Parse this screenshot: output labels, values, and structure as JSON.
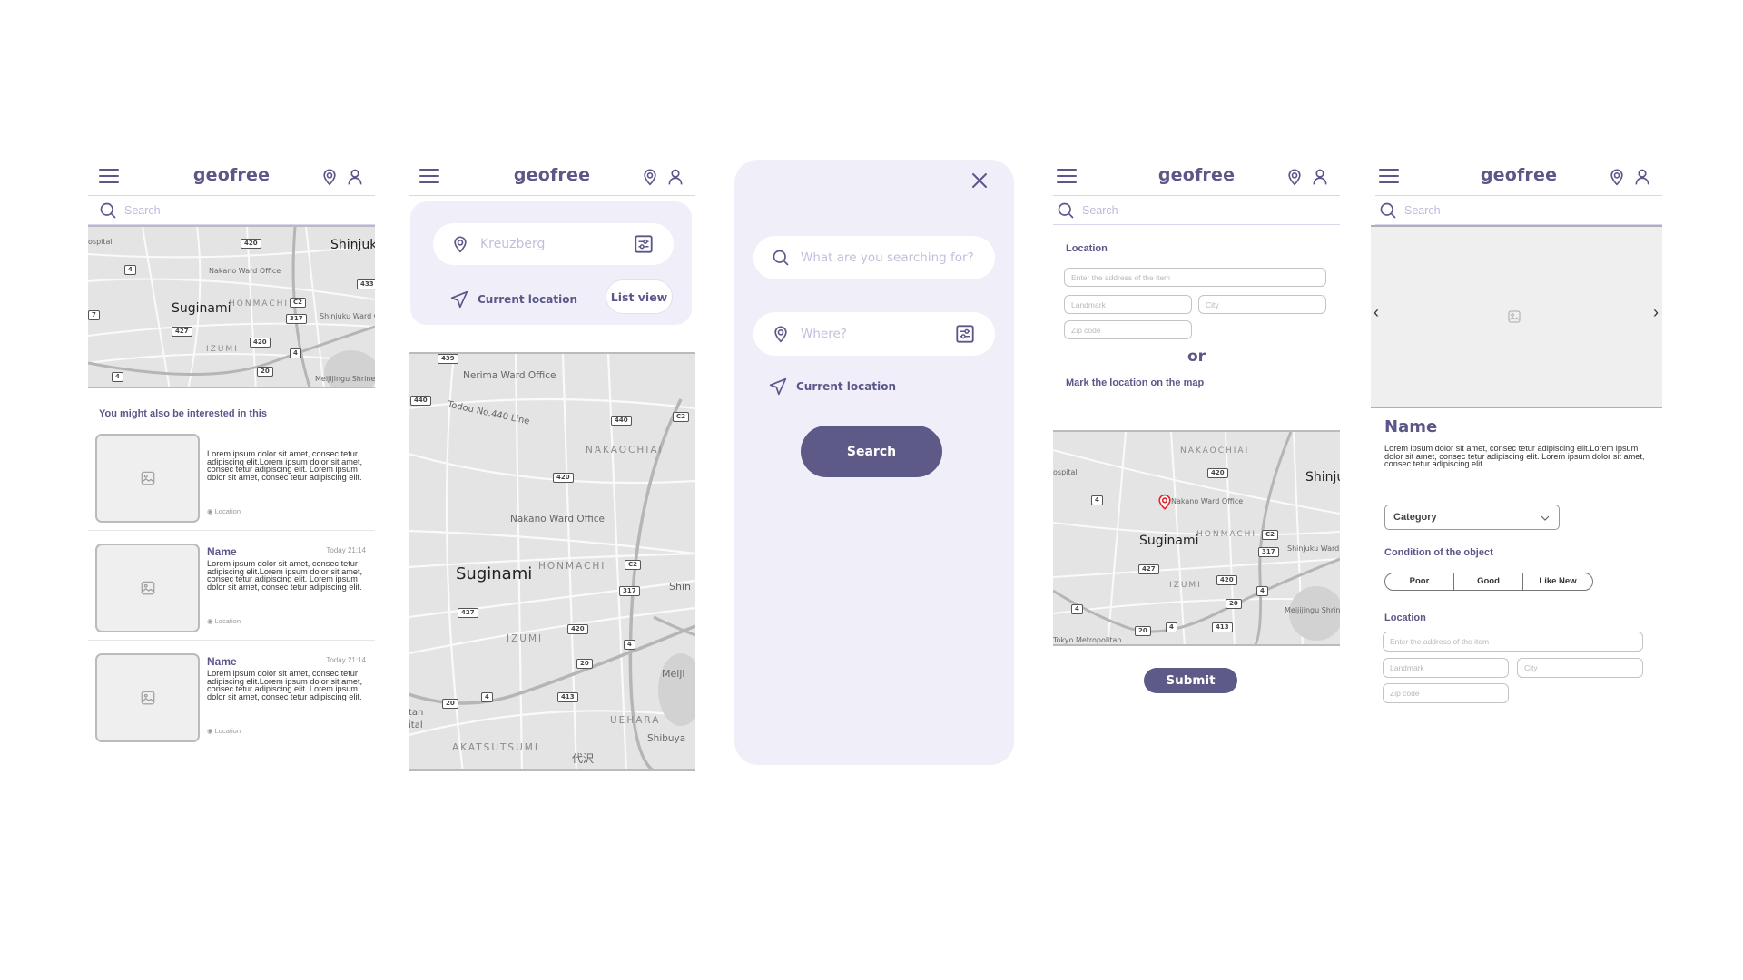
{
  "app": {
    "brand": "geofree",
    "search_placeholder": "Search"
  },
  "colors": {
    "accent": "#5b5789",
    "panel_bg": "#f0eff9",
    "map_pin": "#e0262c"
  },
  "icons": {
    "menu": "hamburger-icon",
    "location": "map-pin-icon",
    "profile": "user-icon",
    "search": "search-icon",
    "filter": "filter-sliders-icon",
    "navigate": "navigation-arrow-icon",
    "close": "close-icon",
    "image": "image-placeholder-icon",
    "prev": "chevron-left-icon",
    "next": "chevron-right-icon",
    "dropdown": "chevron-down-icon"
  },
  "map": {
    "labels": {
      "suginami": "Suginami",
      "shinjuku": "Shinjuk",
      "shinjuku_short": "Shinju",
      "shinjuku_large": "Shin",
      "nakano_office": "Nakano Ward Office",
      "nerima_office": "Nerima Ward Office",
      "shinjuku_office": "Shinjuku Ward O",
      "honmachi": "HONMACHI",
      "izumi": "IZUMI",
      "nakaochiai": "NAKAOCHIAI",
      "uehara": "UEHARA",
      "akatsutsumi": "AKATSUTSUMI",
      "meijijingu": "Meijijingu Shrine",
      "meijijingu_short": "Meiji",
      "shibuya": "Shibuya",
      "hospital": "ospital",
      "todou_line": "Todou No.440 Line",
      "daizawa": "代沢",
      "tokyo_metropolitan": "Tokyo Metropolitan",
      "tan": "tan",
      "ital": "ital"
    },
    "routes": [
      "420",
      "4",
      "433",
      "C2",
      "317",
      "427",
      "20",
      "7",
      "439",
      "440",
      "413"
    ]
  },
  "screen1": {
    "section_title": "You might also be interested in this",
    "items": [
      {
        "name": "",
        "time": "",
        "description": "Lorem ipsum dolor sit amet, consec tetur adipiscing elit.Lorem ipsum dolor sit amet, consec tetur adipiscing elit. Lorem ipsum dolor sit amet, consec tetur adipiscing elit.",
        "location": "Location"
      },
      {
        "name": "Name",
        "time": "Today 21:14",
        "description": "Lorem ipsum dolor sit amet, consec tetur adipiscing elit.Lorem ipsum dolor sit amet, consec tetur adipiscing elit. Lorem ipsum dolor sit amet, consec tetur adipiscing elit.",
        "location": "Location"
      },
      {
        "name": "Name",
        "time": "Today 21:14",
        "description": "Lorem ipsum dolor sit amet, consec tetur adipiscing elit.Lorem ipsum dolor sit amet, consec tetur adipiscing elit. Lorem ipsum dolor sit amet, consec tetur adipiscing elit.",
        "location": "Location"
      }
    ]
  },
  "screen2": {
    "location_placeholder": "Kreuzberg",
    "current_location": "Current location",
    "list_view": "List view"
  },
  "screen3": {
    "what_placeholder": "What are you searching for?",
    "where_placeholder": "Where?",
    "current_location": "Current location",
    "search_button": "Search"
  },
  "screen4": {
    "location_title": "Location",
    "address_placeholder": "Enter the address of the item",
    "landmark_placeholder": "Landmark",
    "city_placeholder": "City",
    "zip_placeholder": "Zip code",
    "or_label": "or",
    "map_instruction": "Mark the location on the map",
    "submit_button": "Submit"
  },
  "screen5": {
    "item_name": "Name",
    "description": "Lorem ipsum dolor sit amet, consec tetur adipiscing elit.Lorem ipsum dolor sit amet, consec tetur adipiscing elit. Lorem ipsum dolor sit amet, consec tetur adipiscing elit.",
    "category_selected": "Category",
    "condition_title": "Condition of the object",
    "conditions": [
      "Poor",
      "Good",
      "Like New"
    ],
    "location_title": "Location",
    "address_placeholder": "Enter the address of the item",
    "landmark_placeholder": "Landmark",
    "city_placeholder": "City",
    "zip_placeholder": "Zip code"
  }
}
